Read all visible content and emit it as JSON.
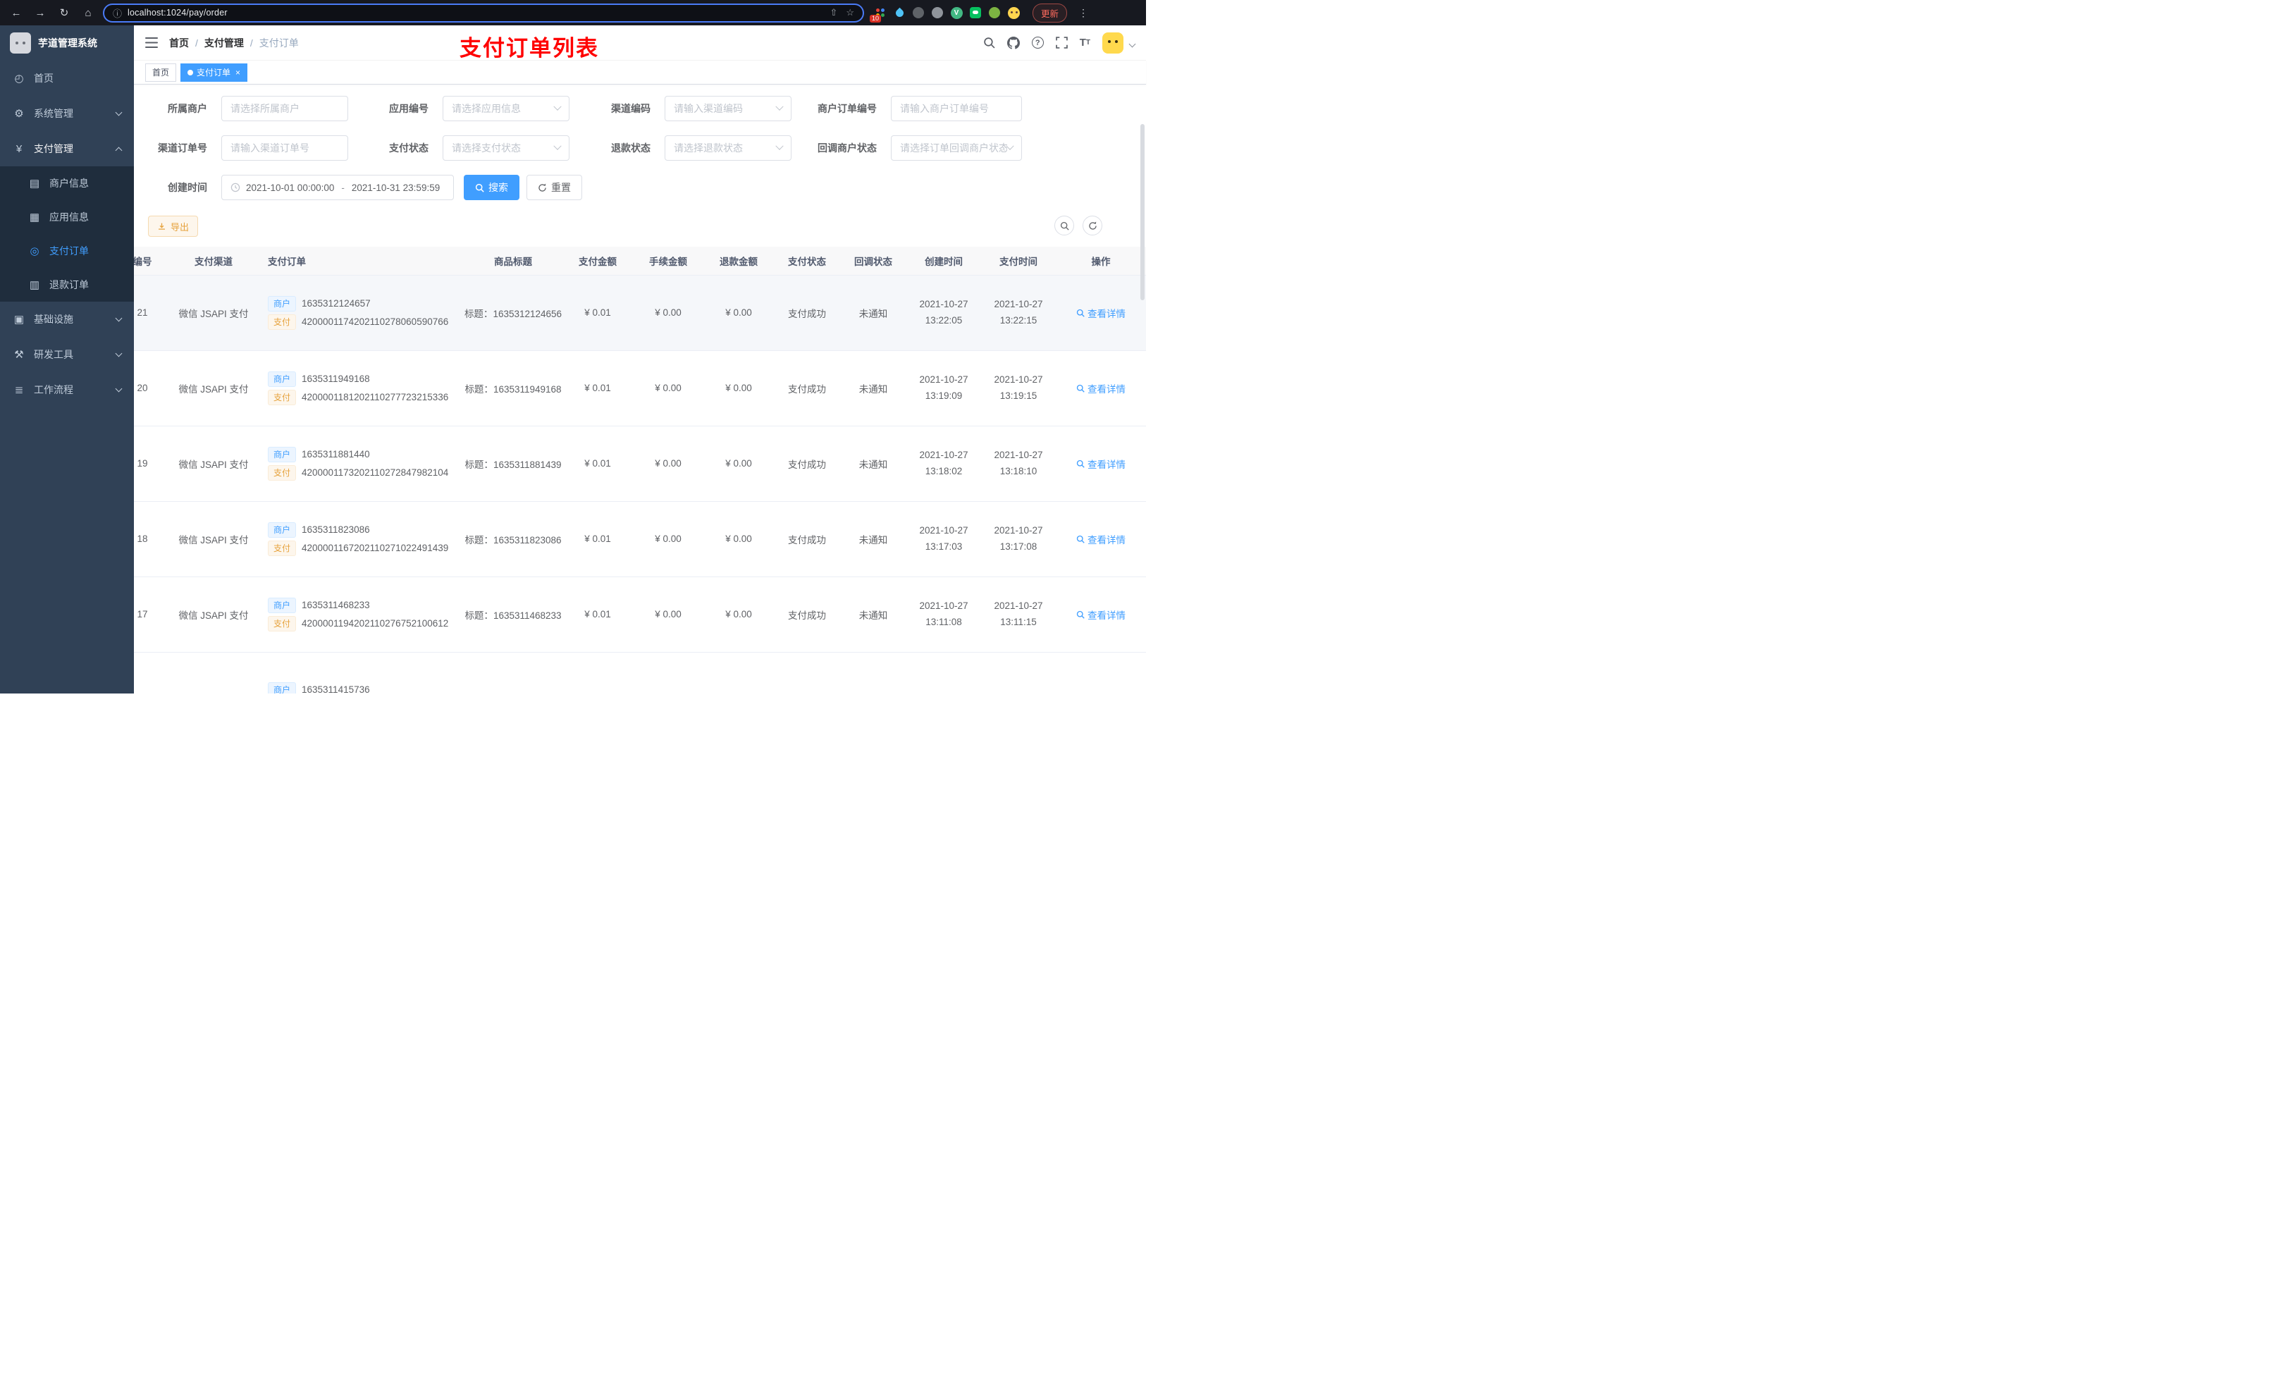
{
  "browser": {
    "url": "localhost:1024/pay/order",
    "update_button": "更新",
    "extension_badge": "10"
  },
  "sidebar": {
    "logo_title": "芋道管理系统",
    "menu": {
      "home": "首页",
      "system": "系统管理",
      "payment": "支付管理",
      "merchant_info": "商户信息",
      "app_info": "应用信息",
      "pay_order": "支付订单",
      "refund_order": "退款订单",
      "infrastructure": "基础设施",
      "dev_tools": "研发工具",
      "workflow": "工作流程"
    }
  },
  "header": {
    "breadcrumb": [
      "首页",
      "支付管理",
      "支付订单"
    ],
    "annotation": "支付订单列表"
  },
  "tabs": [
    {
      "label": "首页",
      "active": false
    },
    {
      "label": "支付订单",
      "active": true
    }
  ],
  "filters": {
    "merchant": {
      "label": "所属商户",
      "placeholder": "请选择所属商户"
    },
    "app": {
      "label": "应用编号",
      "placeholder": "请选择应用信息"
    },
    "channel_code": {
      "label": "渠道编码",
      "placeholder": "请输入渠道编码"
    },
    "merchant_order_no": {
      "label": "商户订单编号",
      "placeholder": "请输入商户订单编号"
    },
    "channel_order_no": {
      "label": "渠道订单号",
      "placeholder": "请输入渠道订单号"
    },
    "pay_status": {
      "label": "支付状态",
      "placeholder": "请选择支付状态"
    },
    "refund_status": {
      "label": "退款状态",
      "placeholder": "请选择退款状态"
    },
    "callback_status": {
      "label": "回调商户状态",
      "placeholder": "请选择订单回调商户状态"
    },
    "create_time": {
      "label": "创建时间",
      "start": "2021-10-01 00:00:00",
      "separator": "-",
      "end": "2021-10-31 23:59:59"
    },
    "search_button": "搜索",
    "reset_button": "重置"
  },
  "toolbar": {
    "export_button": "导出"
  },
  "table": {
    "columns": [
      "编号",
      "支付渠道",
      "支付订单",
      "商品标题",
      "支付金额",
      "手续金额",
      "退款金额",
      "支付状态",
      "回调状态",
      "创建时间",
      "支付时间",
      "操作"
    ],
    "merchant_tag": "商户",
    "pay_tag": "支付",
    "title_prefix": "标题：",
    "action_label": "查看详情",
    "rows": [
      {
        "id": "21",
        "channel": "微信 JSAPI 支付",
        "merchant_no": "1635312124657",
        "pay_no": "4200001174202110278060590766",
        "title": "1635312124656",
        "amount": "¥ 0.01",
        "fee": "¥ 0.00",
        "refund": "¥ 0.00",
        "status": "支付成功",
        "notify": "未通知",
        "create_date": "2021-10-27",
        "create_time": "13:22:05",
        "pay_date": "2021-10-27",
        "pay_time": "13:22:15"
      },
      {
        "id": "20",
        "channel": "微信 JSAPI 支付",
        "merchant_no": "1635311949168",
        "pay_no": "4200001181202110277723215336",
        "title": "1635311949168",
        "amount": "¥ 0.01",
        "fee": "¥ 0.00",
        "refund": "¥ 0.00",
        "status": "支付成功",
        "notify": "未通知",
        "create_date": "2021-10-27",
        "create_time": "13:19:09",
        "pay_date": "2021-10-27",
        "pay_time": "13:19:15"
      },
      {
        "id": "19",
        "channel": "微信 JSAPI 支付",
        "merchant_no": "1635311881440",
        "pay_no": "4200001173202110272847982104",
        "title": "1635311881439",
        "amount": "¥ 0.01",
        "fee": "¥ 0.00",
        "refund": "¥ 0.00",
        "status": "支付成功",
        "notify": "未通知",
        "create_date": "2021-10-27",
        "create_time": "13:18:02",
        "pay_date": "2021-10-27",
        "pay_time": "13:18:10"
      },
      {
        "id": "18",
        "channel": "微信 JSAPI 支付",
        "merchant_no": "1635311823086",
        "pay_no": "4200001167202110271022491439",
        "title": "1635311823086",
        "amount": "¥ 0.01",
        "fee": "¥ 0.00",
        "refund": "¥ 0.00",
        "status": "支付成功",
        "notify": "未通知",
        "create_date": "2021-10-27",
        "create_time": "13:17:03",
        "pay_date": "2021-10-27",
        "pay_time": "13:17:08"
      },
      {
        "id": "17",
        "channel": "微信 JSAPI 支付",
        "merchant_no": "1635311468233",
        "pay_no": "4200001194202110276752100612",
        "title": "1635311468233",
        "amount": "¥ 0.01",
        "fee": "¥ 0.00",
        "refund": "¥ 0.00",
        "status": "支付成功",
        "notify": "未通知",
        "create_date": "2021-10-27",
        "create_time": "13:11:08",
        "pay_date": "2021-10-27",
        "pay_time": "13:11:15"
      }
    ],
    "partial_row": {
      "merchant_no": "1635311415736"
    }
  },
  "colors": {
    "accent": "#409eff",
    "warning": "#e6a23c",
    "annotation": "#ff0000",
    "sidebar_bg": "#304156",
    "submenu_bg": "#1f2d3d"
  }
}
